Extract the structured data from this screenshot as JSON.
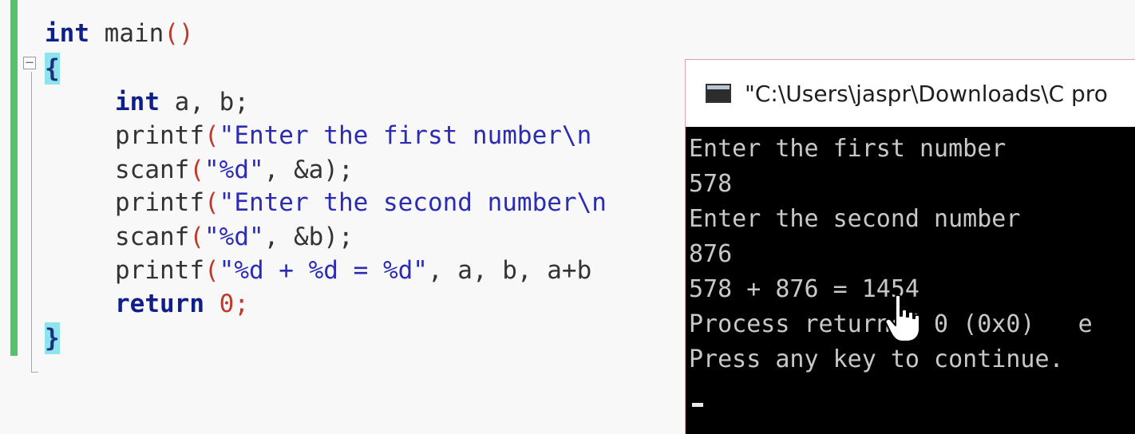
{
  "editor": {
    "lines": {
      "l1": {
        "kw": "int",
        "name": " main",
        "paren": "()"
      },
      "l2": {
        "brace": "{"
      },
      "l3": {
        "kw": "int",
        "rest": " a, b;"
      },
      "l4": {
        "fn": "printf",
        "paren": "(",
        "str": "\"Enter the first number\\n"
      },
      "l5": {
        "fn": "scanf",
        "paren": "(",
        "str": "\"%d\"",
        "rest": ", &a);"
      },
      "l6": {
        "fn": "printf",
        "paren": "(",
        "str": "\"Enter the second number\\n"
      },
      "l7": {
        "fn": "scanf",
        "paren": "(",
        "str": "\"%d\"",
        "rest": ", &b);"
      },
      "l8": {
        "fn": "printf",
        "paren": "(",
        "str": "\"%d + %d = %d\"",
        "rest": ", a, b, a+b"
      },
      "l9": {
        "kw": "return",
        "num": " 0",
        "rest": ";"
      },
      "l10": {
        "brace": "}"
      }
    },
    "fold_toggle": "−"
  },
  "console": {
    "title": "\"C:\\Users\\jaspr\\Downloads\\C pro",
    "output": [
      "Enter the first number",
      "578",
      "Enter the second number",
      "876",
      "578 + 876 = 1454",
      "Process returned 0 (0x0)   e",
      "Press any key to continue."
    ]
  },
  "colors": {
    "change_bar": "#55c26a",
    "keyword": "#0f1f8a",
    "string": "#2b2bb3",
    "number": "#c03a2b",
    "brace_highlight": "#8ee4ec",
    "console_bg": "#000000",
    "console_text": "#c8c8c8"
  },
  "icons": {
    "console_app": "console-window-icon",
    "pointer": "hand-cursor-icon"
  }
}
